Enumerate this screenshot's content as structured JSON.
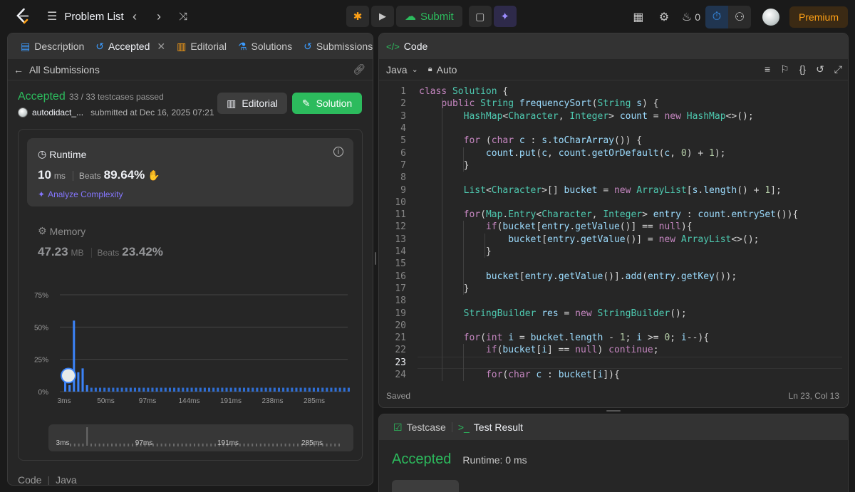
{
  "topbar": {
    "problem_list": "Problem List",
    "submit": "Submit",
    "streak": "0",
    "premium": "Premium"
  },
  "left_tabs": [
    {
      "label": "Description"
    },
    {
      "label": "Accepted"
    },
    {
      "label": "Editorial"
    },
    {
      "label": "Solutions"
    },
    {
      "label": "Submissions"
    }
  ],
  "submission": {
    "back_label": "All Submissions",
    "status": "Accepted",
    "passed": "33 / 33 testcases passed",
    "user": "autodidact_...",
    "submitted": "submitted at Dec 16, 2025 07:21",
    "editorial_btn": "Editorial",
    "solution_btn": "Solution"
  },
  "runtime": {
    "title": "Runtime",
    "value": "10",
    "unit": "ms",
    "beats_label": "Beats",
    "beats": "89.64%",
    "analyze": "Analyze Complexity"
  },
  "memory": {
    "title": "Memory",
    "value": "47.23",
    "unit": "MB",
    "beats_label": "Beats",
    "beats": "23.42%"
  },
  "chart_data": {
    "type": "bar",
    "y_ticks": [
      "75%",
      "50%",
      "25%",
      "0%"
    ],
    "x_ticks": [
      "3ms",
      "50ms",
      "97ms",
      "144ms",
      "191ms",
      "238ms",
      "285ms"
    ],
    "values": [
      8,
      5,
      55,
      15,
      18,
      5,
      3,
      3,
      3,
      3,
      3,
      3,
      3,
      3,
      3,
      3,
      3,
      3,
      3,
      3,
      3,
      3,
      3,
      3,
      3,
      3,
      3,
      3,
      3,
      3,
      3,
      3,
      3,
      3,
      3,
      3,
      3,
      3,
      3,
      3,
      3,
      3,
      3,
      3,
      3,
      3,
      3,
      3,
      3,
      3,
      3,
      3,
      3,
      3,
      3,
      3,
      3,
      3,
      3,
      3,
      3,
      3,
      3,
      3,
      3,
      3
    ],
    "ylim": [
      0,
      75
    ],
    "scrubber_ticks": [
      "3ms",
      "97ms",
      "191ms",
      "285ms"
    ]
  },
  "footer_left": {
    "code": "Code",
    "lang": "Java"
  },
  "code_panel": {
    "title": "Code",
    "language": "Java",
    "mode": "Auto",
    "status": "Saved",
    "cursor": "Ln 23, Col 13"
  },
  "code_lines": [
    "class Solution {",
    "    public String frequencySort(String s) {",
    "        HashMap<Character, Integer> count = new HashMap<>();",
    "",
    "        for (char c : s.toCharArray()) {",
    "            count.put(c, count.getOrDefault(c, 0) + 1);",
    "        }",
    "",
    "        List<Character>[] bucket = new ArrayList[s.length() + 1];",
    "",
    "        for(Map.Entry<Character, Integer> entry : count.entrySet()){",
    "            if(bucket[entry.getValue()] == null){",
    "                bucket[entry.getValue()] = new ArrayList<>();",
    "            }",
    "",
    "            bucket[entry.getValue()].add(entry.getKey());",
    "        }",
    "",
    "        StringBuilder res = new StringBuilder();",
    "",
    "        for(int i = bucket.length - 1; i >= 0; i--){",
    "            if(bucket[i] == null) continue;",
    "",
    "            for(char c : bucket[i]){"
  ],
  "result_panel": {
    "testcase_tab": "Testcase",
    "result_tab": "Test Result",
    "status": "Accepted",
    "runtime": "Runtime: 0 ms"
  }
}
